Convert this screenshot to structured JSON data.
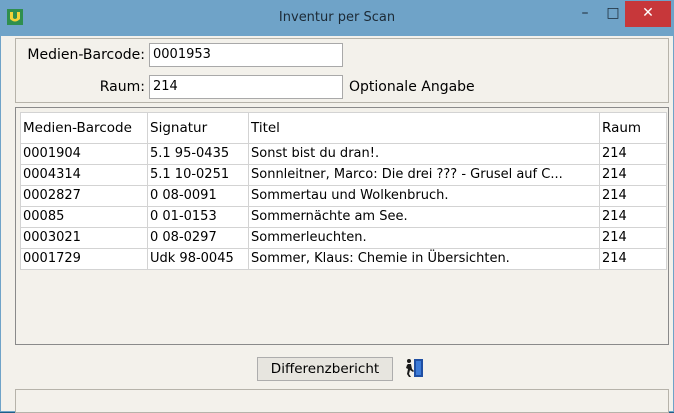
{
  "window": {
    "title": "Inventur per Scan",
    "minimize": "–",
    "maximize": "□",
    "close": "✕"
  },
  "form": {
    "barcode_label": "Medien-Barcode:",
    "barcode_value": "0001953",
    "raum_label": "Raum:",
    "raum_value": "214",
    "raum_hint": "Optionale Angabe"
  },
  "table": {
    "headers": [
      "Medien-Barcode",
      "Signatur",
      "Titel",
      "Raum"
    ],
    "rows": [
      [
        "0001904",
        "5.1 95-0435",
        "Sonst bist du dran!.",
        "214"
      ],
      [
        "0004314",
        "5.1 10-0251",
        "Sonnleitner, Marco: Die drei ??? - Grusel auf C...",
        "214"
      ],
      [
        "0002827",
        "0 08-0091",
        "Sommertau und Wolkenbruch.",
        "214"
      ],
      [
        "00085",
        "0 01-0153",
        "Sommernächte am See.",
        "214"
      ],
      [
        "0003021",
        "0 08-0297",
        "Sommerleuchten.",
        "214"
      ],
      [
        "0001729",
        "Udk 98-0045",
        "Sommer, Klaus: Chemie in Übersichten.",
        "214"
      ]
    ]
  },
  "footer": {
    "diff_button": "Differenzbericht"
  },
  "colors": {
    "titlebar": "#6fa3c8",
    "close": "#c7373a",
    "window_bg": "#f3f1eb"
  },
  "icons": {
    "app": "app-logo-icon",
    "exit": "exit-door-icon"
  }
}
